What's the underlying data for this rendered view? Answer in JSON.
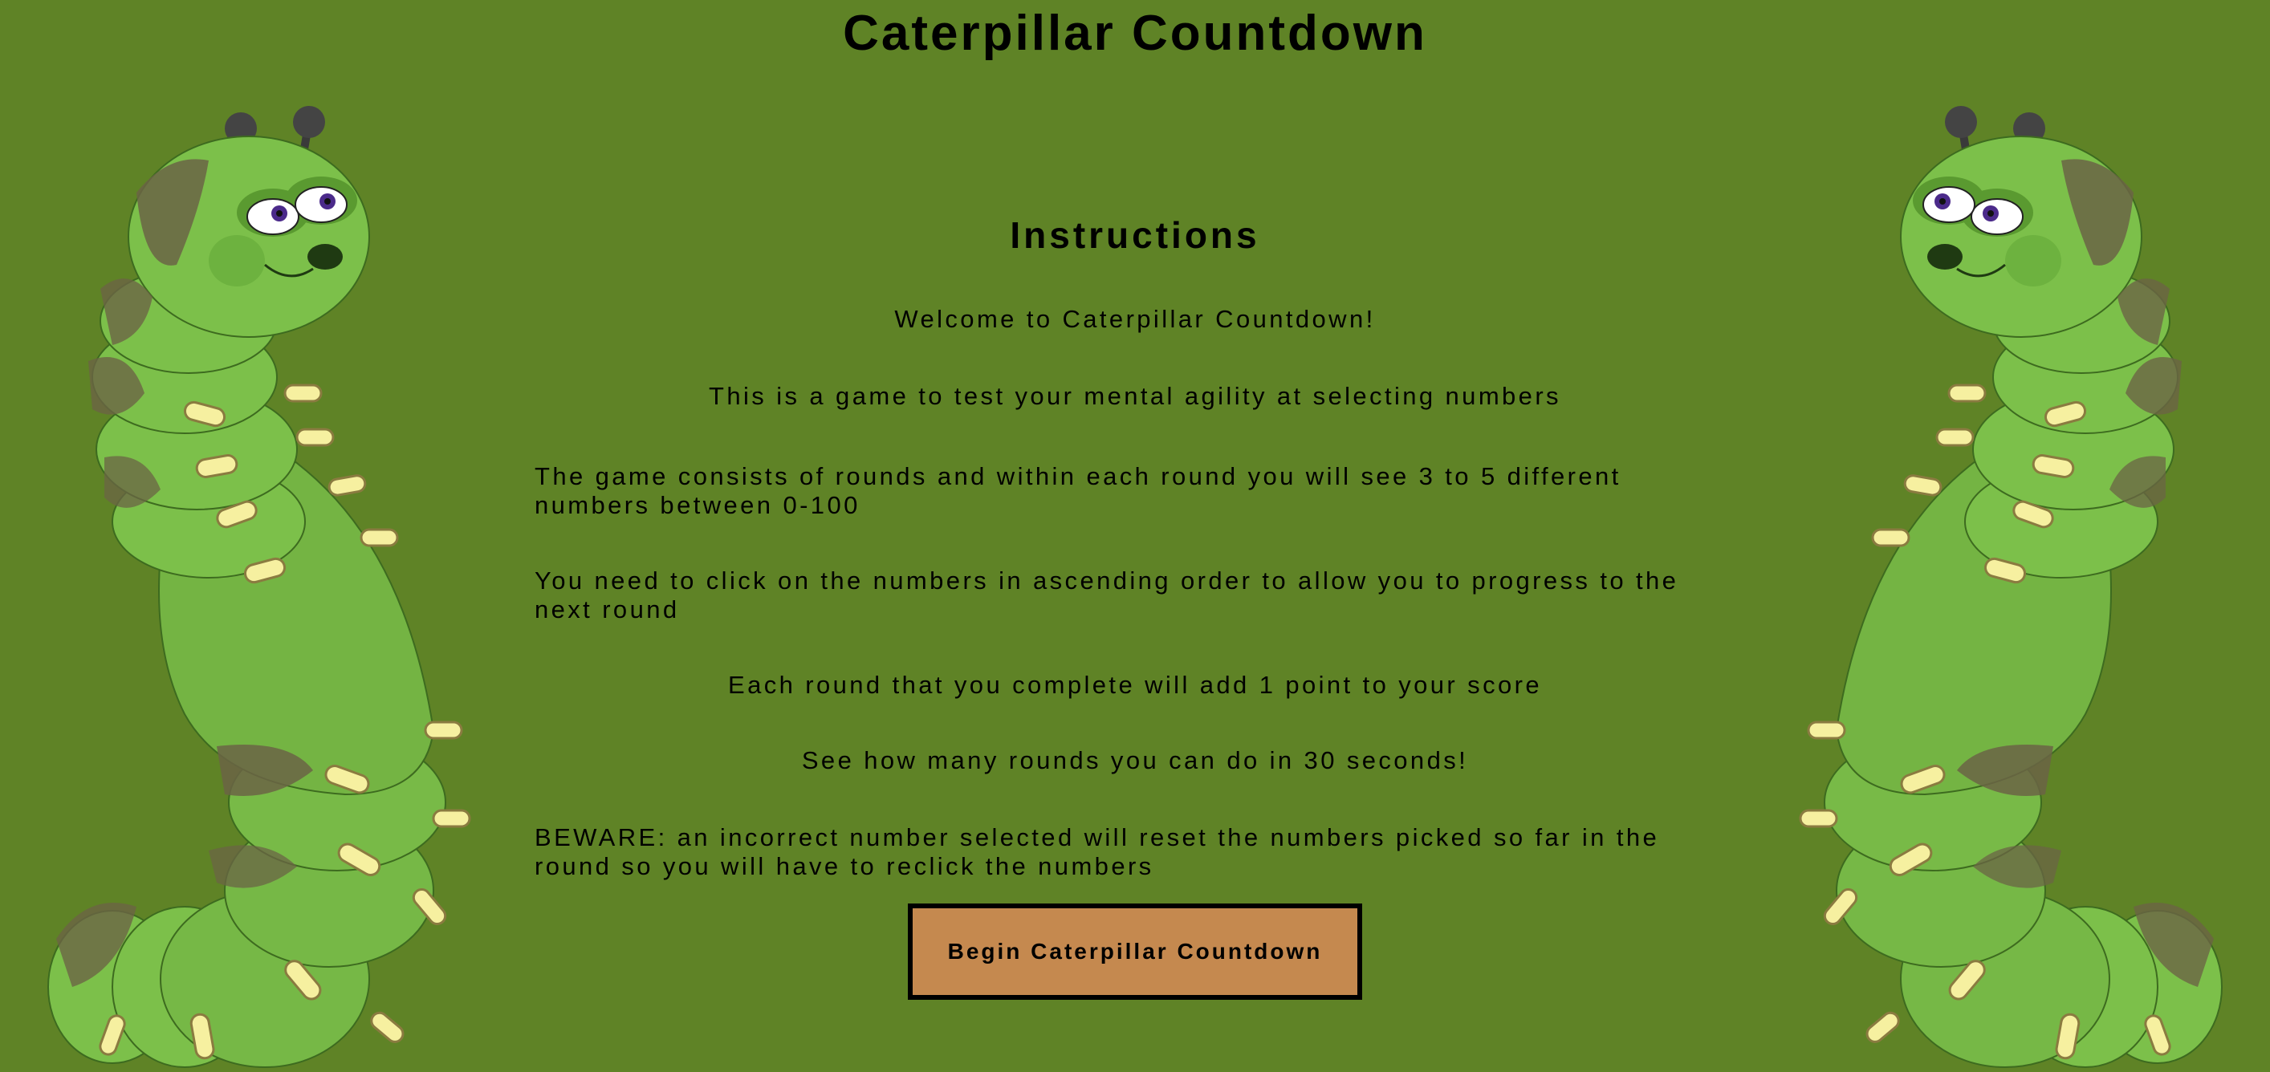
{
  "title": "Caterpillar Countdown",
  "instructions": {
    "heading": "Instructions",
    "welcome": "Welcome to Caterpillar Countdown!",
    "intro": "This is a game to test your mental agility at selecting numbers",
    "rounds": "The game consists of rounds and within each round you will see 3 to 5 different numbers between 0-100",
    "ascending": "You need to click on the numbers in ascending order to allow you to progress to the next round",
    "scoring": "Each round that you complete will add 1 point to your score",
    "time": "See how many rounds you can do in 30 seconds!",
    "beware": "BEWARE: an incorrect number selected will reset the numbers picked so far in the round so you will have to reclick the numbers"
  },
  "begin_button": "Begin Caterpillar Countdown",
  "colors": {
    "background": "#5f8326",
    "button": "#c5894f",
    "caterpillar_body": "#7cc04a",
    "caterpillar_patch": "#6b6445",
    "legs": "#f6f0a0"
  },
  "icons": [
    "caterpillar-left-illustration",
    "caterpillar-right-illustration"
  ]
}
